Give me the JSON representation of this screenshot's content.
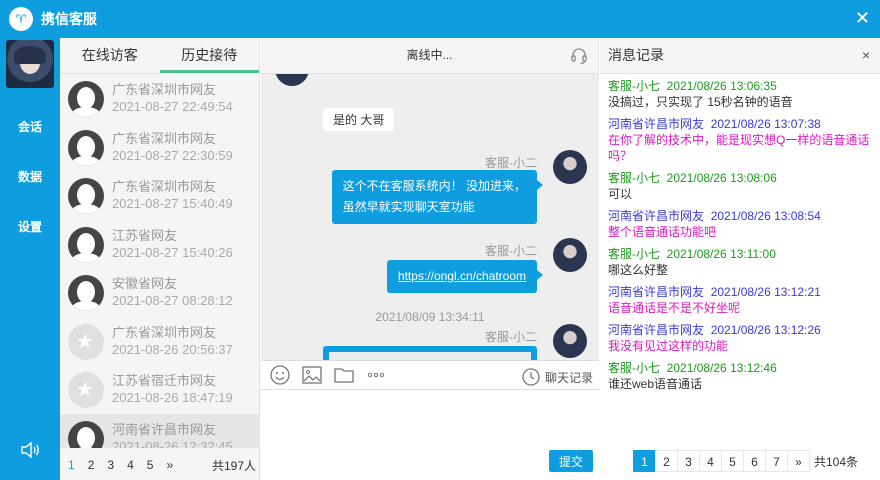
{
  "window": {
    "title": "携信客服",
    "colors": {
      "accent": "#0e9ee0",
      "tab_underline": "#4fc08d"
    }
  },
  "rail": {
    "items": [
      "会话",
      "数据",
      "设置"
    ]
  },
  "visitors": {
    "tabs": [
      "在线访客",
      "历史接待"
    ],
    "active_tab": 1,
    "items": [
      {
        "name": "广东省深圳市网友",
        "time": "2021-08-27 22:49:54",
        "online": true
      },
      {
        "name": "广东省深圳市网友",
        "time": "2021-08-27 22:30:59",
        "online": true
      },
      {
        "name": "广东省深圳市网友",
        "time": "2021-08-27 15:40:49",
        "online": true
      },
      {
        "name": "江苏省网友",
        "time": "2021-08-27 15:40:26",
        "online": true
      },
      {
        "name": "安徽省网友",
        "time": "2021-08-27 08:28:12",
        "online": true
      },
      {
        "name": "广东省深圳市网友",
        "time": "2021-08-26 20:56:37",
        "online": false
      },
      {
        "name": "江苏省宿迁市网友",
        "time": "2021-08-26 18:47:19",
        "online": false
      },
      {
        "name": "河南省许昌市网友",
        "time": "2021-08-26 12:32:45",
        "online": true
      }
    ],
    "pager": {
      "pages": [
        "1",
        "2",
        "3",
        "4",
        "5",
        "»"
      ],
      "total": "共197人"
    }
  },
  "chat": {
    "status": "离线中...",
    "messages": {
      "first_left": "是的 大哥",
      "m1_sender": "客服-小二",
      "m1_line1": "这个不在客服系统内！ 没加进来，",
      "m1_line2": "虽然早就实现聊天室功能",
      "m2_sender": "客服-小二",
      "m2_link": "https://ongl.cn/chatroom",
      "timestamp": "2021/08/09 13:34:11",
      "m3_sender": "客服-小二"
    },
    "tools": [
      "emoji-icon",
      "image-icon",
      "folder-icon",
      "more-icon"
    ],
    "history_label": "聊天记录",
    "submit_label": "提交"
  },
  "records": {
    "title": "消息记录",
    "close": "×",
    "items": [
      {
        "who": "客服-小七",
        "time": "2021/08/26 13:06:35",
        "text": "没搞过，只实现了 15秒名钟的语音",
        "role": "agent"
      },
      {
        "who": "河南省许昌市网友",
        "time": "2021/08/26 13:07:38",
        "text": "在你了解的技术中，能是现实想Q一样的语音通话吗？",
        "role": "visitor"
      },
      {
        "who": "客服-小七",
        "time": "2021/08/26 13:08:06",
        "text": "可以",
        "role": "agent"
      },
      {
        "who": "河南省许昌市网友",
        "time": "2021/08/26 13:08:54",
        "text": "整个语音通话功能吧",
        "role": "visitor"
      },
      {
        "who": "客服-小七",
        "time": "2021/08/26 13:11:00",
        "text": "哪这么好整",
        "role": "agent"
      },
      {
        "who": "河南省许昌市网友",
        "time": "2021/08/26 13:12:21",
        "text": "语音通话是不是不好坐呢",
        "role": "visitor"
      },
      {
        "who": "河南省许昌市网友",
        "time": "2021/08/26 13:12:26",
        "text": "我没有见过这样的功能",
        "role": "visitor"
      },
      {
        "who": "客服-小七",
        "time": "2021/08/26 13:12:46",
        "text": "谁还web语音通话",
        "role": "agent"
      }
    ],
    "pager": {
      "pages": [
        "1",
        "2",
        "3",
        "4",
        "5",
        "6",
        "7",
        "»"
      ],
      "total": "共104条"
    }
  }
}
